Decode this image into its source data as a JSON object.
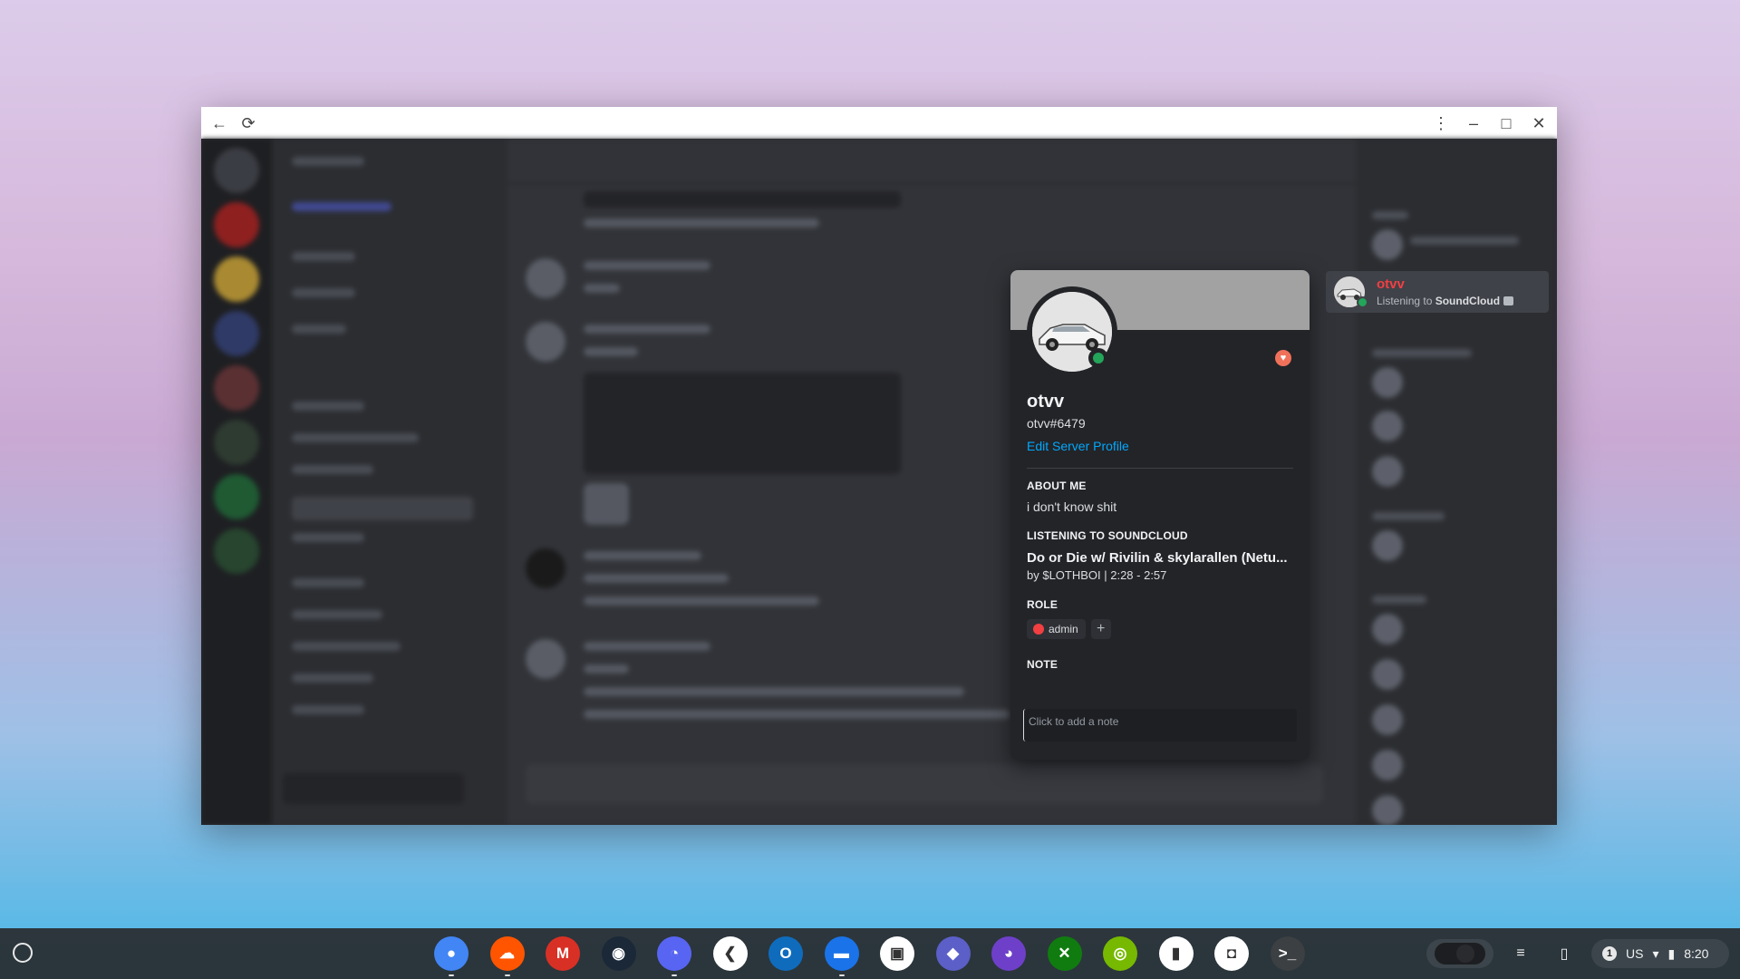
{
  "browser": {
    "back_icon": "←",
    "reload_icon": "⟳",
    "menu_icon": "⋮",
    "minimize_icon": "–",
    "maximize_icon": "□",
    "close_icon": "✕"
  },
  "member_list": {
    "selected_member": {
      "name": "otvv",
      "activity_prefix": "Listening to ",
      "activity_app": "SoundCloud"
    }
  },
  "profile": {
    "display_name": "otvv",
    "tag": "otvv#6479",
    "edit_label": "Edit Server Profile",
    "about_heading": "ABOUT ME",
    "about_text": "i don't know shit",
    "listening_heading": "LISTENING TO SOUNDCLOUD",
    "song_title": "Do or Die w/ Rivilin & skylarallen (Netu...",
    "song_meta": "by $LOTHBOI   |   2:28 - 2:57",
    "role_heading": "ROLE",
    "role_name": "admin",
    "role_add_icon": "+",
    "note_heading": "NOTE",
    "note_placeholder": "Click to add a note",
    "badge_icon": "♥",
    "colors": {
      "username": "#f23f42",
      "link": "#00a8fc",
      "status_online": "#23a55a",
      "banner": "#a2a2a2"
    }
  },
  "shelf": {
    "apps": [
      {
        "name": "chrome-icon",
        "glyph": "●",
        "bg": "#4285f4"
      },
      {
        "name": "soundcloud-icon",
        "glyph": "☁",
        "bg": "#ff5500"
      },
      {
        "name": "gmail-icon",
        "glyph": "M",
        "bg": "#d93025"
      },
      {
        "name": "steam-icon",
        "glyph": "◉",
        "bg": "#1b2838"
      },
      {
        "name": "discord-icon",
        "glyph": "◔",
        "bg": "#5865f2"
      },
      {
        "name": "vscode-icon",
        "glyph": "❮",
        "bg": "#ffffff"
      },
      {
        "name": "outlook-icon",
        "glyph": "O",
        "bg": "#0f6cbd"
      },
      {
        "name": "files-icon",
        "glyph": "▬",
        "bg": "#1a73e8"
      },
      {
        "name": "twitch-icon",
        "glyph": "▣",
        "bg": "#ffffff"
      },
      {
        "name": "app-diamond-icon",
        "glyph": "◆",
        "bg": "#5b5fc7"
      },
      {
        "name": "github-icon",
        "glyph": "◕",
        "bg": "#6e40c9"
      },
      {
        "name": "xbox-icon",
        "glyph": "✕",
        "bg": "#107c10"
      },
      {
        "name": "nvidia-icon",
        "glyph": "◎",
        "bg": "#76b900"
      },
      {
        "name": "deezer-icon",
        "glyph": "▮",
        "bg": "#ffffff"
      },
      {
        "name": "authenticator-icon",
        "glyph": "◘",
        "bg": "#ffffff"
      },
      {
        "name": "terminal-icon",
        "glyph": ">_",
        "bg": "#3c4043"
      }
    ],
    "status": {
      "notification_count": "1",
      "locale": "US",
      "time": "8:20"
    }
  }
}
